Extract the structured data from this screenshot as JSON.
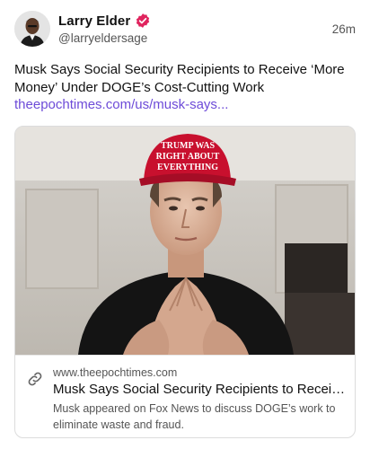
{
  "post": {
    "author_name": "Larry Elder",
    "author_handle": "@larryeldersage",
    "timestamp": "26m",
    "verified": true,
    "text": "Musk Says Social Security Recipients to Receive ‘More Money’ Under DOGE’s Cost-Cutting Work",
    "link_text": "theepochtimes.com/us/musk-says..."
  },
  "card": {
    "image_subject": "Man in red cap with steepled hands",
    "cap_text": "TRUMP WAS RIGHT ABOUT EVERYTHING",
    "domain": "www.theepochtimes.com",
    "title": "Musk Says Social Security Recipients to Receive ‘More Money’ Under DOGE’s Cost-Cutting Work",
    "description": "Musk appeared on Fox News to discuss DOGE’s work to eliminate waste and fraud."
  },
  "colors": {
    "link": "#6d4bd8",
    "verified_badge": "#e0245e",
    "cap_red": "#c8102e"
  },
  "icons": {
    "verified": "verified-badge-icon",
    "link": "link-icon"
  }
}
